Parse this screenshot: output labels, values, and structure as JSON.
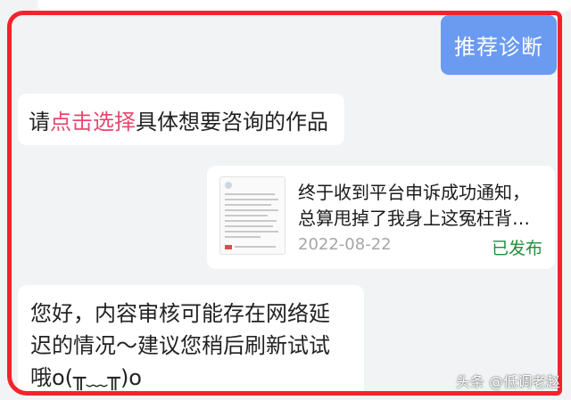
{
  "diagnose_button": {
    "label": "推荐诊断"
  },
  "prompt": {
    "before": "请",
    "highlight": "点击选择",
    "after": "具体想要咨询的作品"
  },
  "work_card": {
    "title_line1": "终于收到平台申诉成功通知，",
    "title_line2": "总算甩掉了我身上这冤枉背…",
    "date": "2022-08-22",
    "status": "已发布"
  },
  "reply": {
    "line1": "您好，内容审核可能存在网络延",
    "line2": "迟的情况～建议您稍后刷新试试",
    "line3": "哦o(╥﹏╥)o"
  },
  "watermark": "头条 @低调老赵",
  "colors": {
    "button_bg": "#6b9bf0",
    "highlight": "#e8476f",
    "status_green": "#1f8f3a",
    "frame_red": "#f0252c"
  }
}
